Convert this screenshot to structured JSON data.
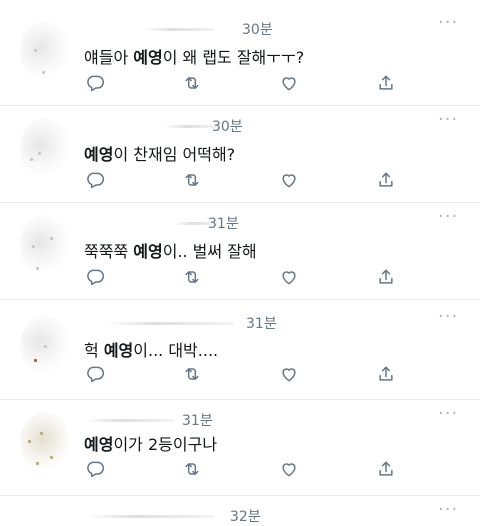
{
  "colors": {
    "text": "#14171a",
    "muted": "#657786",
    "divider": "#e6ecf0"
  },
  "tweets": [
    {
      "time": "30분",
      "text_before": "얘들아 ",
      "highlight": "예영",
      "text_after": "이 왜 랩도 잘해ㅜㅜ?"
    },
    {
      "time": "30분",
      "text_before": "",
      "highlight": "예영",
      "text_after": "이 찬재임 어떡해?"
    },
    {
      "time": "31분",
      "text_before": "쭉쭉쭉 ",
      "highlight": "예영",
      "text_after": "이.. 벌써 잘해"
    },
    {
      "time": "31분",
      "text_before": "헉 ",
      "highlight": "예영",
      "text_after": "이... 대박...."
    },
    {
      "time": "31분",
      "text_before": "",
      "highlight": "예영",
      "text_after": "이가 2등이구나"
    },
    {
      "time": "32분"
    }
  ],
  "icons": {
    "reply": "reply-icon",
    "retweet": "retweet-icon",
    "like": "heart-icon",
    "share": "share-icon",
    "more": "more-options-icon"
  }
}
